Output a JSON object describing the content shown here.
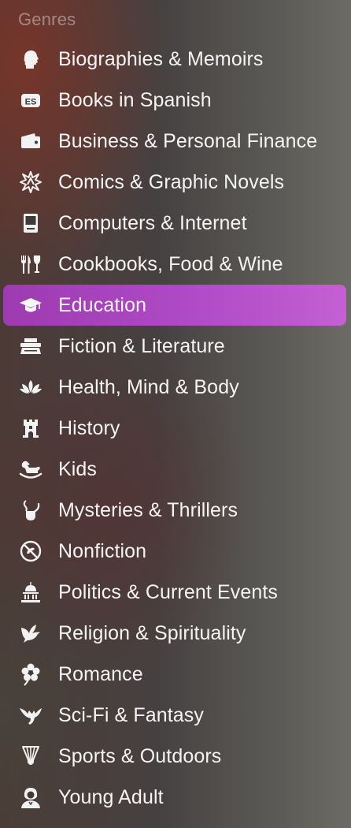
{
  "section_header": "Genres",
  "items": [
    {
      "label": "Biographies & Memoirs",
      "icon": "bust-silhouette-icon"
    },
    {
      "label": "Books in Spanish",
      "icon": "es-badge-icon"
    },
    {
      "label": "Business & Personal Finance",
      "icon": "wallet-icon"
    },
    {
      "label": "Comics & Graphic Novels",
      "icon": "comic-burst-icon"
    },
    {
      "label": "Computers & Internet",
      "icon": "desktop-computer-icon"
    },
    {
      "label": "Cookbooks, Food & Wine",
      "icon": "fork-knife-glass-icon"
    },
    {
      "label": "Education",
      "icon": "graduation-cap-icon"
    },
    {
      "label": "Fiction & Literature",
      "icon": "typewriter-icon"
    },
    {
      "label": "Health, Mind & Body",
      "icon": "lotus-icon"
    },
    {
      "label": "History",
      "icon": "castle-tower-icon"
    },
    {
      "label": "Kids",
      "icon": "rocking-horse-icon"
    },
    {
      "label": "Mysteries & Thrillers",
      "icon": "magnifier-pipe-icon"
    },
    {
      "label": "Nonfiction",
      "icon": "no-dragon-icon"
    },
    {
      "label": "Politics & Current Events",
      "icon": "capitol-building-icon"
    },
    {
      "label": "Religion & Spirituality",
      "icon": "dove-icon"
    },
    {
      "label": "Romance",
      "icon": "flower-icon"
    },
    {
      "label": "Sci-Fi & Fantasy",
      "icon": "dragon-icon"
    },
    {
      "label": "Sports & Outdoors",
      "icon": "shuttlecock-icon"
    },
    {
      "label": "Young Adult",
      "icon": "young-adult-person-icon"
    }
  ],
  "selected_label": "Education",
  "colors": {
    "selection": "#b04ac6",
    "header_text": "#8d8a88",
    "item_text": "#f4f4f4"
  }
}
